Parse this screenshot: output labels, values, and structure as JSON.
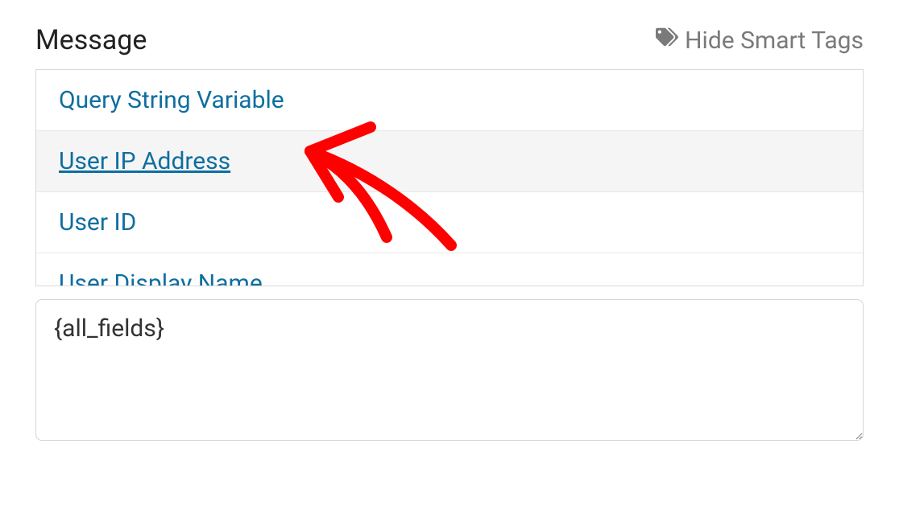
{
  "section": {
    "title": "Message",
    "hide_tags_label": "Hide Smart Tags"
  },
  "tags": {
    "items": [
      {
        "label": "Query String Variable"
      },
      {
        "label": "User IP Address"
      },
      {
        "label": "User ID"
      },
      {
        "label": "User Display Name"
      }
    ]
  },
  "message_field": {
    "value": "{all_fields}"
  }
}
